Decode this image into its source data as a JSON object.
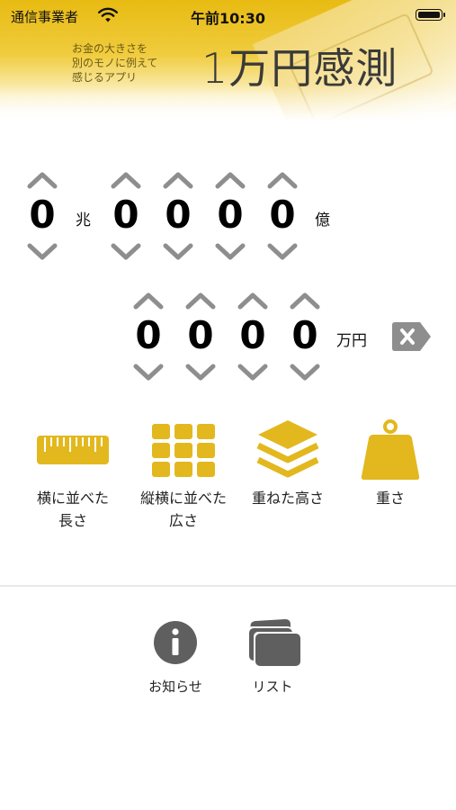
{
  "status_bar": {
    "carrier": "通信事業者",
    "time": "午前10:30"
  },
  "header": {
    "tagline": [
      "お金の大きさを",
      "別のモノに例えて",
      "感じるアプリ"
    ],
    "title": "1万円感測"
  },
  "amount": {
    "cho_digit": "0",
    "cho_unit": "兆",
    "oku_digits": [
      "0",
      "0",
      "0",
      "0"
    ],
    "oku_unit": "億",
    "man_digits": [
      "0",
      "0",
      "0",
      "0"
    ],
    "man_unit": "万円"
  },
  "modes": [
    {
      "label_lines": [
        "横に並べた",
        "長さ"
      ],
      "icon": "ruler-icon"
    },
    {
      "label_lines": [
        "縦横に並べた",
        "広さ"
      ],
      "icon": "grid-icon"
    },
    {
      "label_lines": [
        "重ねた高さ"
      ],
      "icon": "stack-icon"
    },
    {
      "label_lines": [
        "重さ"
      ],
      "icon": "weight-icon"
    }
  ],
  "footer": {
    "info_label": "お知らせ",
    "list_label": "リスト"
  },
  "colors": {
    "accent": "#E2B81E",
    "chevron": "#8E8E8E",
    "icon_gray": "#5F5F5F"
  }
}
